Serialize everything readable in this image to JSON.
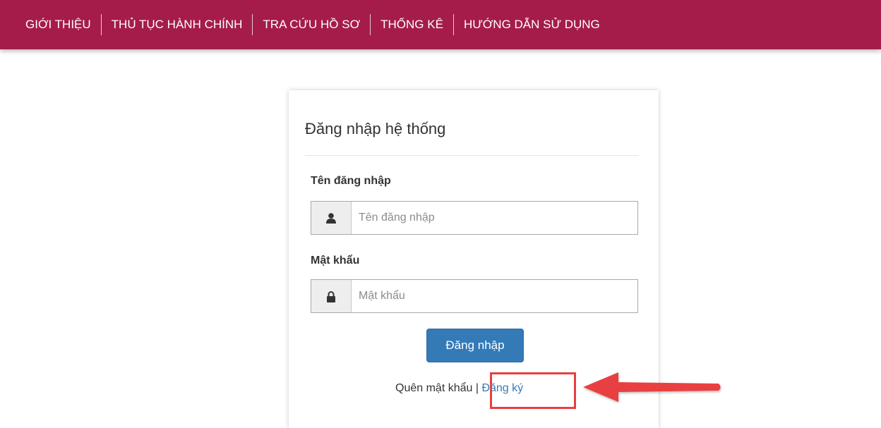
{
  "nav": {
    "items": [
      {
        "label": "GIỚI THIỆU"
      },
      {
        "label": "THỦ TỤC HÀNH CHÍNH"
      },
      {
        "label": "TRA CỨU HỒ SƠ"
      },
      {
        "label": "THỐNG KÊ"
      },
      {
        "label": "HƯỚNG DẪN SỬ DỤNG"
      }
    ]
  },
  "login": {
    "title": "Đăng nhập hệ thống",
    "username": {
      "label": "Tên đăng nhập",
      "placeholder": "Tên đăng nhập",
      "value": "",
      "icon": "user-icon"
    },
    "password": {
      "label": "Mật khẩu",
      "placeholder": "Mật khẩu",
      "value": "",
      "icon": "lock-icon"
    },
    "submit_label": "Đăng nhập",
    "forgot_label": "Quên mật khẩu",
    "separator": " | ",
    "register_label": "Đăng ký"
  },
  "colors": {
    "navbar": "#a51c4a",
    "primary": "#337ab7",
    "annotation": "#e8403f"
  }
}
